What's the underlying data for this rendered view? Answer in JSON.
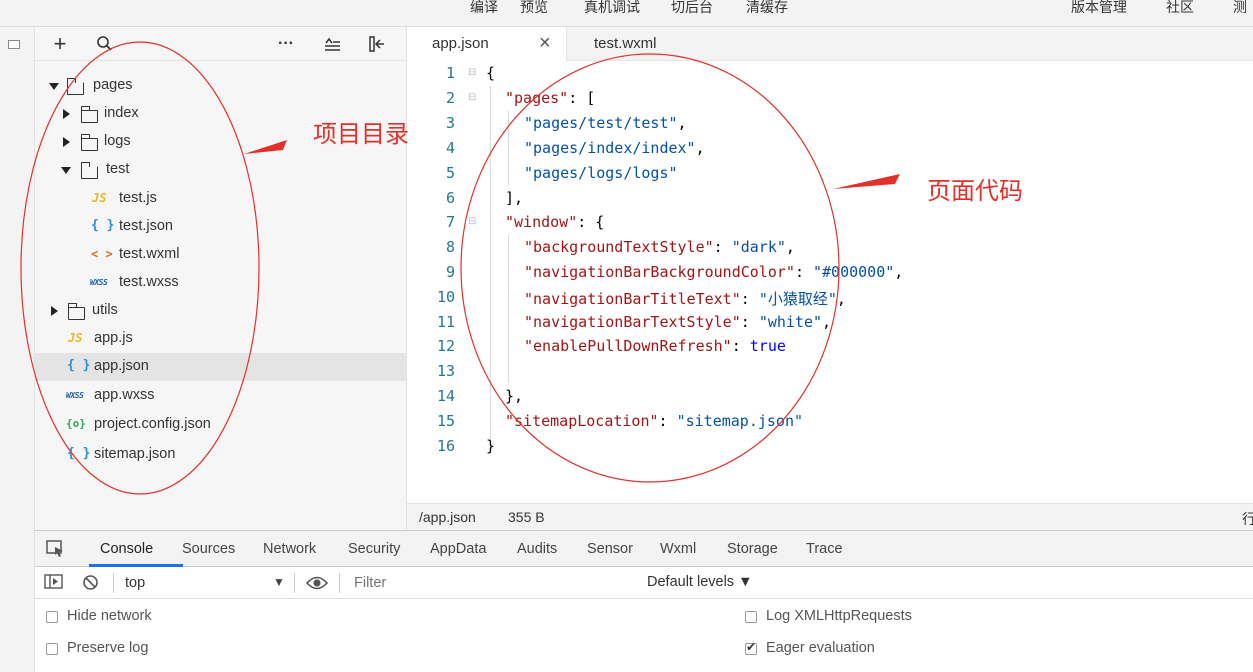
{
  "toolbar": {
    "items": [
      "编译",
      "预览",
      "真机调试",
      "切后台",
      "清缓存"
    ],
    "right_items": [
      "版本管理",
      "社区",
      "测"
    ]
  },
  "explorer": {
    "tools": {
      "add": "+",
      "more": "···"
    },
    "tree": [
      {
        "label": "pages",
        "type": "folder",
        "expanded": true
      },
      {
        "label": "index",
        "type": "folder",
        "expanded": false
      },
      {
        "label": "logs",
        "type": "folder",
        "expanded": false
      },
      {
        "label": "test",
        "type": "folder",
        "expanded": true
      },
      {
        "label": "test.js",
        "type": "js"
      },
      {
        "label": "test.json",
        "type": "json"
      },
      {
        "label": "test.wxml",
        "type": "wxml"
      },
      {
        "label": "test.wxss",
        "type": "wxss"
      },
      {
        "label": "utils",
        "type": "folder",
        "expanded": false
      },
      {
        "label": "app.js",
        "type": "js"
      },
      {
        "label": "app.json",
        "type": "json",
        "selected": true
      },
      {
        "label": "app.wxss",
        "type": "wxss"
      },
      {
        "label": "project.config.json",
        "type": "config"
      },
      {
        "label": "sitemap.json",
        "type": "json"
      }
    ],
    "icon_glyphs": {
      "js": "JS",
      "json": "{ }",
      "wxml": "< >",
      "wxss": "WXSS",
      "config": "{o}"
    }
  },
  "editor": {
    "tabs": [
      {
        "label": "app.json",
        "active": true,
        "close": "×"
      },
      {
        "label": "test.wxml",
        "active": false
      }
    ],
    "line_numbers": [
      "1",
      "2",
      "3",
      "4",
      "5",
      "6",
      "7",
      "8",
      "9",
      "10",
      "11",
      "12",
      "13",
      "14",
      "15",
      "16"
    ],
    "code": {
      "l1": "{",
      "l2_key": "\"pages\"",
      "l2_rest": ": [",
      "l3": "\"pages/test/test\"",
      "l4": "\"pages/index/index\"",
      "l5": "\"pages/logs/logs\"",
      "l6": "],",
      "l7_key": "\"window\"",
      "l7_rest": ": {",
      "l8_key": "\"backgroundTextStyle\"",
      "l8_val": "\"dark\"",
      "l9_key": "\"navigationBarBackgroundColor\"",
      "l9_val": "\"#000000\"",
      "l10_key": "\"navigationBarTitleText\"",
      "l10_val": "\"小猿取经\"",
      "l11_key": "\"navigationBarTextStyle\"",
      "l11_val": "\"white\"",
      "l12_key": "\"enablePullDownRefresh\"",
      "l12_val": "true",
      "l14": "},",
      "l15_key": "\"sitemapLocation\"",
      "l15_val": "\"sitemap.json\"",
      "l16": "}",
      "colon": ": ",
      "comma": ","
    }
  },
  "statusbar": {
    "path": "/app.json",
    "size": "355 B",
    "right": "行"
  },
  "devtools": {
    "tabs": [
      "Console",
      "Sources",
      "Network",
      "Security",
      "AppData",
      "Audits",
      "Sensor",
      "Wxml",
      "Storage",
      "Trace"
    ],
    "context": "top",
    "filter_placeholder": "Filter",
    "levels": "Default levels ▼",
    "options": {
      "hide_network": "Hide network",
      "preserve_log": "Preserve log",
      "log_xhr": "Log XMLHttpRequests",
      "eager_eval": "Eager evaluation"
    },
    "option_states": {
      "hide_network": false,
      "preserve_log": false,
      "log_xhr": false,
      "eager_eval": true
    }
  },
  "annotations": {
    "directory": "项目目录",
    "page_code": "页面代码",
    "color": "#e2302a"
  }
}
